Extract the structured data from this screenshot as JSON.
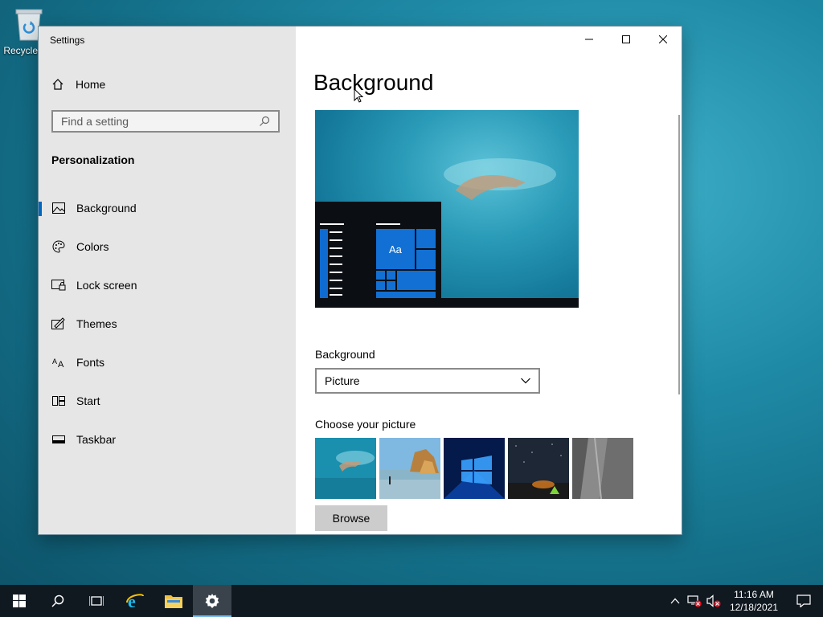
{
  "desktop": {
    "recycle_bin_label": "Recycle Bin"
  },
  "window": {
    "title": "Settings",
    "sidebar": {
      "home_label": "Home",
      "search_placeholder": "Find a setting",
      "section_title": "Personalization",
      "items": [
        {
          "label": "Background",
          "icon": "picture-icon",
          "active": true
        },
        {
          "label": "Colors",
          "icon": "palette-icon",
          "active": false
        },
        {
          "label": "Lock screen",
          "icon": "lock-screen-icon",
          "active": false
        },
        {
          "label": "Themes",
          "icon": "themes-icon",
          "active": false
        },
        {
          "label": "Fonts",
          "icon": "fonts-icon",
          "active": false
        },
        {
          "label": "Start",
          "icon": "start-icon",
          "active": false
        },
        {
          "label": "Taskbar",
          "icon": "taskbar-icon",
          "active": false
        }
      ]
    },
    "content": {
      "page_title": "Background",
      "preview_sample_text": "Aa",
      "background_label": "Background",
      "background_value": "Picture",
      "choose_picture_label": "Choose your picture",
      "browse_label": "Browse"
    }
  },
  "taskbar": {
    "clock_time": "11:16 AM",
    "clock_date": "12/18/2021"
  },
  "colors": {
    "accent": "#0067c0",
    "sidebar_bg": "#e6e6e6",
    "taskbar_bg": "#101820"
  }
}
